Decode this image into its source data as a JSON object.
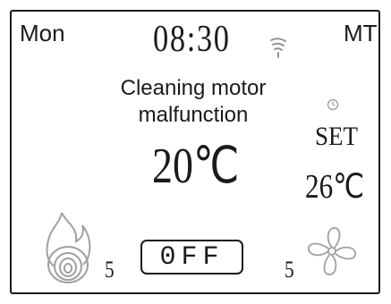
{
  "display": {
    "day": "Mon",
    "mode": "MT",
    "time": "08:30",
    "message": "Cleaning motor malfunction",
    "current_temp": "20℃",
    "set_label": "SET",
    "set_temp": "26℃",
    "flame_level": "5",
    "fan_level": "5",
    "power_button": "0FF"
  },
  "icons": {
    "signal": "wifi-signal-icon",
    "timer": "clock-icon",
    "flame": "flame-icon",
    "fan": "fan-icon"
  },
  "colors": {
    "foreground": "#1a1a1a",
    "background": "#ffffff",
    "icon_faded": "#9a9a9a"
  }
}
